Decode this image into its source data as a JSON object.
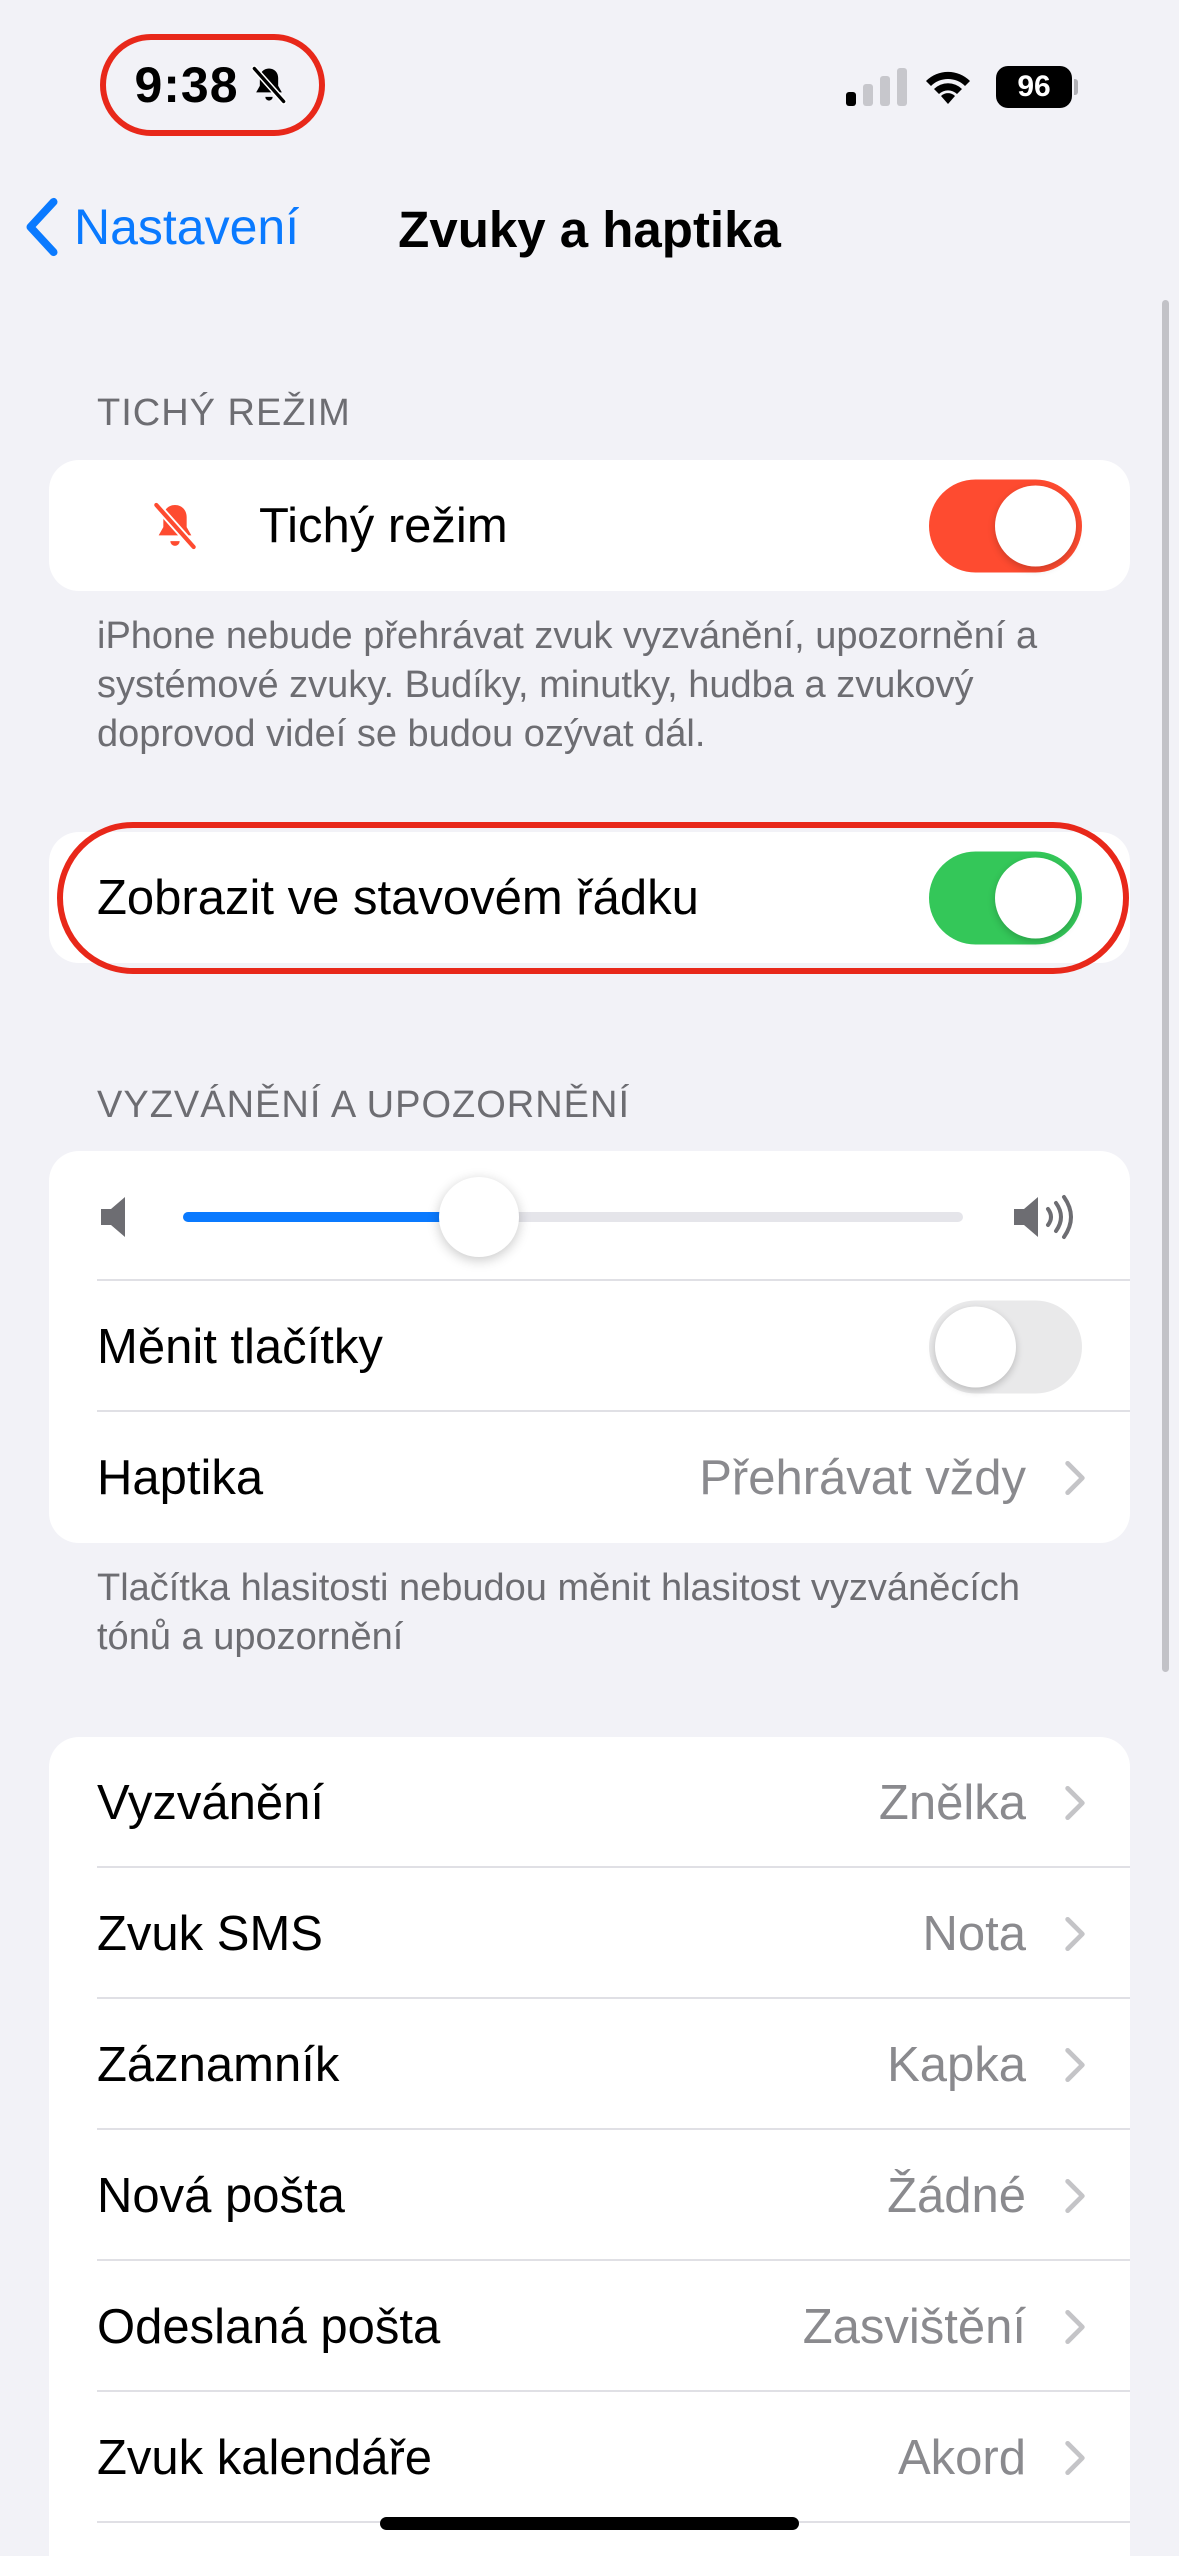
{
  "status_bar": {
    "time": "9:38",
    "battery": "96",
    "icons": [
      "bell-slash-icon",
      "signal-icon",
      "wifi-icon",
      "battery-icon"
    ]
  },
  "nav": {
    "back_label": "Nastavení",
    "title": "Zvuky a haptika"
  },
  "silent_section": {
    "header": "TICHÝ REŽIM",
    "row_label": "Tichý režim",
    "toggle_on": true,
    "toggle_color": "#fe4b30",
    "footer": "iPhone nebude přehrávat zvuk vyzvánění, upozornění a systémové zvuky. Budíky, minutky, hudba a zvukový doprovod videí se budou ozývat dál."
  },
  "status_bar_setting": {
    "label": "Zobrazit ve stavovém řádku",
    "toggle_on": true,
    "toggle_color": "#34c759"
  },
  "ringer_section": {
    "header": "VYZVÁNĚNÍ A UPOZORNĚNÍ",
    "volume_fraction": 0.38,
    "change_with_buttons_label": "Měnit tlačítky",
    "change_with_buttons_on": false,
    "haptics_label": "Haptika",
    "haptics_value": "Přehrávat vždy",
    "footer": "Tlačítka hlasitosti nebudou měnit hlasitost vyzváněcích tónů a upozornění"
  },
  "sounds": [
    {
      "label": "Vyzvánění",
      "value": "Znělka"
    },
    {
      "label": "Zvuk SMS",
      "value": "Nota"
    },
    {
      "label": "Záznamník",
      "value": "Kapka"
    },
    {
      "label": "Nová pošta",
      "value": "Žádné"
    },
    {
      "label": "Odeslaná pošta",
      "value": "Zasvištění"
    },
    {
      "label": "Zvuk kalendáře",
      "value": "Akord"
    }
  ],
  "colors": {
    "accent": "#0a7aff",
    "highlight": "#e8281a",
    "background": "#f2f2f7"
  }
}
